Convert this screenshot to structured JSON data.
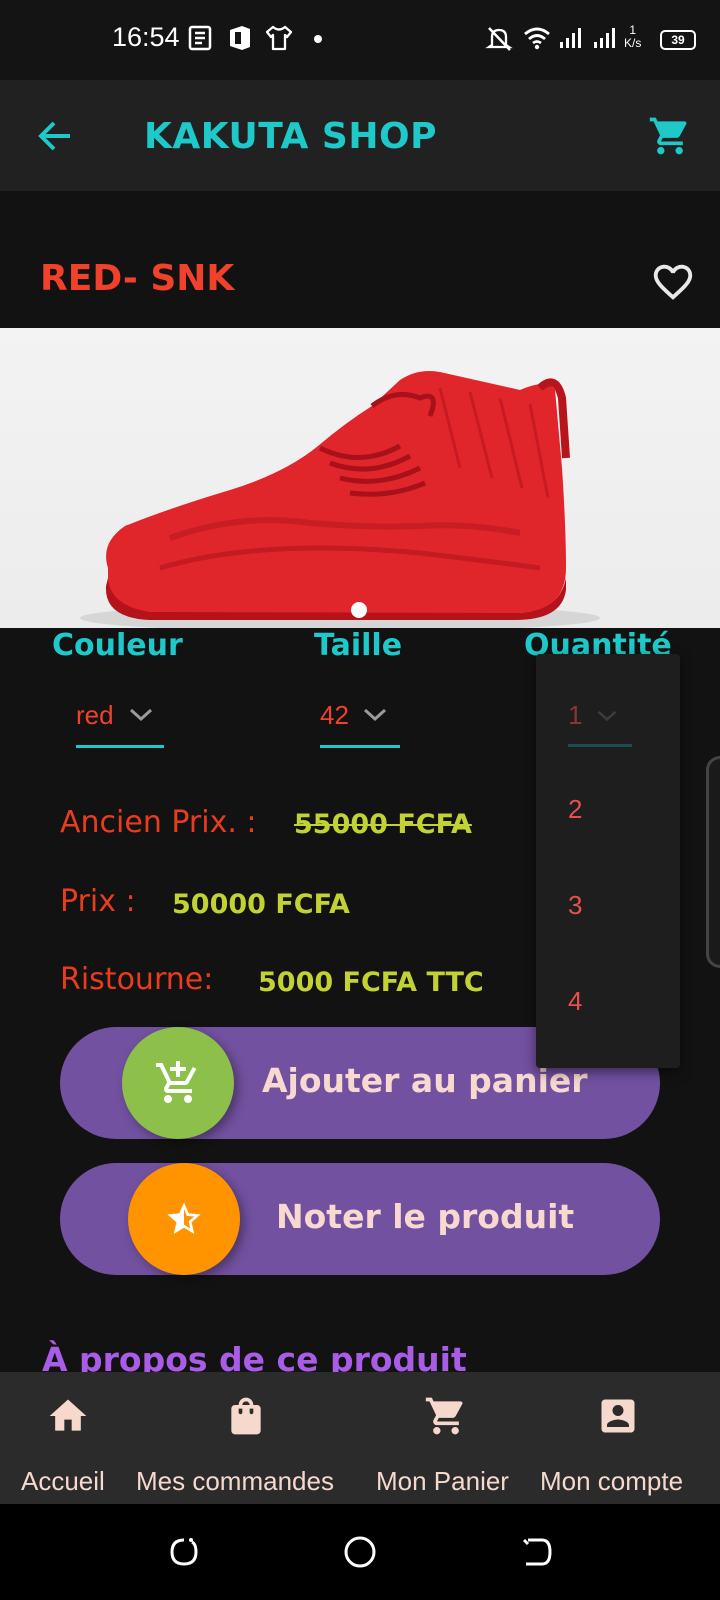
{
  "status_bar": {
    "time": "16:54",
    "net_speed_value": "1",
    "net_speed_unit": "K/s",
    "battery": "39",
    "icons": [
      "news-icon",
      "office-icon",
      "tshirt-icon",
      "dot-icon",
      "bell-off-icon",
      "wifi-icon",
      "signal-icon",
      "signal-icon"
    ]
  },
  "app_bar": {
    "title": "KAKUTA SHOP",
    "back_icon": "arrow-left-icon",
    "cart_icon": "cart-icon"
  },
  "product": {
    "name": "RED- SNK",
    "favorite_icon": "heart-outline-icon",
    "image_alt": "red sneaker",
    "carousel_page": 1
  },
  "options": {
    "color_label": "Couleur",
    "color_value": "red",
    "size_label": "Taille",
    "size_value": "42",
    "quantity_label": "Quantité",
    "quantity_value": "1"
  },
  "quantity_dropdown": [
    "1",
    "2",
    "3",
    "4"
  ],
  "prices": {
    "old_label": "Ancien Prix. :",
    "old_value": "55000 FCFA",
    "price_label": "Prix :",
    "price_value": "50000 FCFA",
    "discount_label": "Ristourne:",
    "discount_value": "5000 FCFA TTC"
  },
  "actions": {
    "add_to_cart": "Ajouter au panier",
    "rate_product": "Noter le  produit"
  },
  "about_title": "À propos de ce produit",
  "bottom_nav": [
    {
      "label": "Accueil",
      "icon": "home-icon"
    },
    {
      "label": "Mes commandes",
      "icon": "shopping-bag-icon"
    },
    {
      "label": "Mon Panier",
      "icon": "cart-icon"
    },
    {
      "label": "Mon compte",
      "icon": "account-icon"
    }
  ],
  "colors": {
    "accent": "#1fc9c9",
    "product_name": "#f0412a",
    "price_value": "#c2d233",
    "button": "#7251a0",
    "add_circle": "#8cc04b",
    "rate_circle": "#ff9400",
    "about": "#a95de6"
  }
}
